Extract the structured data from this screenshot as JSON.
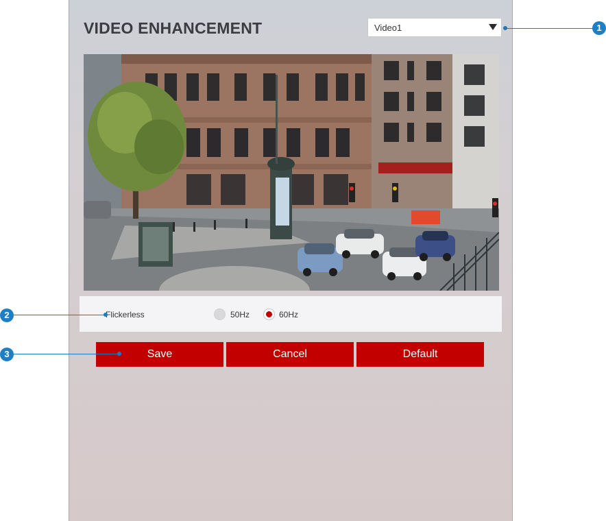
{
  "header": {
    "title": "VIDEO ENHANCEMENT",
    "video_select": {
      "selected": "Video1"
    }
  },
  "preview": {
    "icon": "camera-preview-image"
  },
  "options": {
    "flickerless": {
      "label": "Flickerless",
      "choices": [
        {
          "label": "50Hz",
          "selected": false
        },
        {
          "label": "60Hz",
          "selected": true
        }
      ]
    }
  },
  "buttons": {
    "save": "Save",
    "cancel": "Cancel",
    "default": "Default"
  },
  "callouts": [
    "1",
    "2",
    "3"
  ],
  "colors": {
    "accent_red": "#c20000",
    "callout_blue": "#1f7fc4",
    "panel_bg": "#d4cfd2"
  }
}
